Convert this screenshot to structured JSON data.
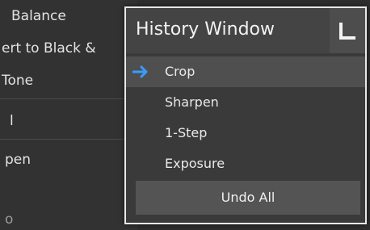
{
  "background_menu": {
    "items": [
      "Balance",
      "ert to Black &",
      "Tone",
      "l",
      "pen",
      "o"
    ]
  },
  "history_window": {
    "title": "History Window",
    "corner_icon": "collapse-corner-icon",
    "items": [
      {
        "label": "Crop",
        "active": true,
        "icon": "arrow-right-icon"
      },
      {
        "label": "Sharpen",
        "active": false
      },
      {
        "label": "1-Step",
        "active": false
      },
      {
        "label": "Exposure",
        "active": false
      }
    ],
    "undo_all_label": "Undo All"
  },
  "colors": {
    "accent_arrow": "#3a9bff",
    "window_border": "#e8e8e8"
  }
}
